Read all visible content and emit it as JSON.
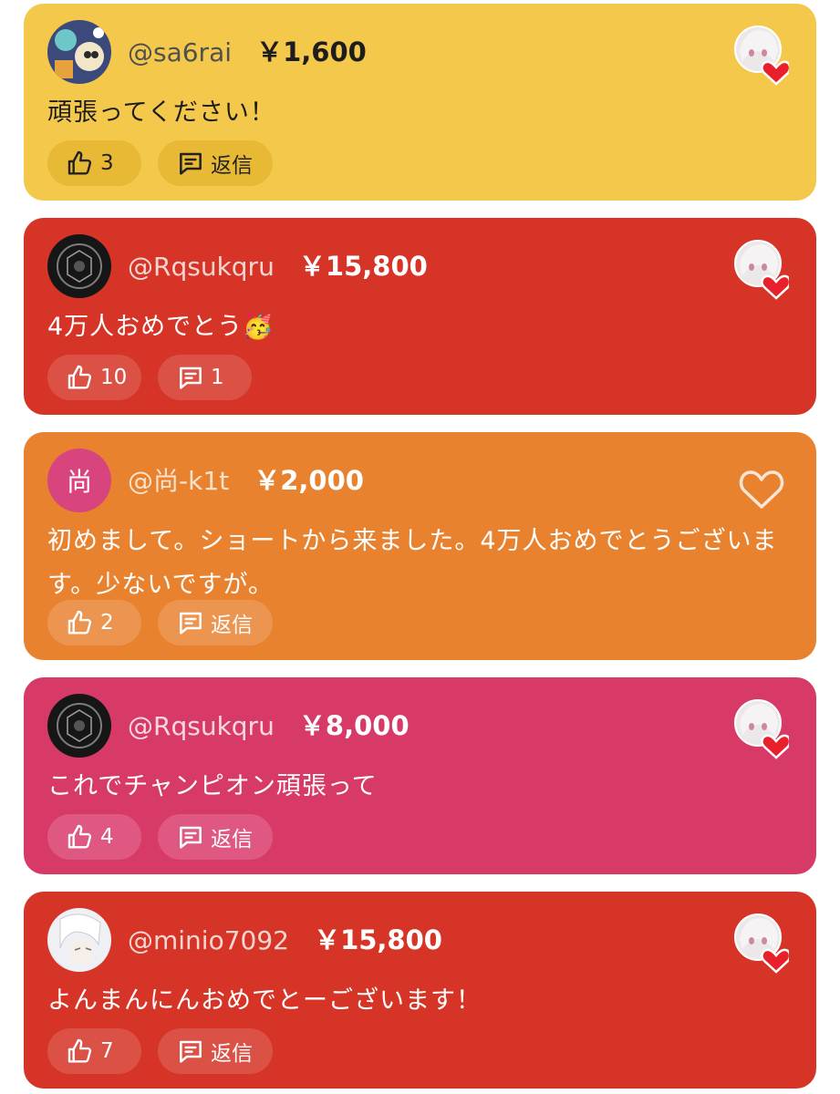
{
  "comments": [
    {
      "theme": "yellow",
      "username": "@sa6rai",
      "amount": "￥1,600",
      "message": "頑張ってください！",
      "likes": "3",
      "reply_label": "返信",
      "creator_hearted": true
    },
    {
      "theme": "red",
      "username": "@Rqsukqru",
      "amount": "￥15,800",
      "message": "4万人おめでとう🥳",
      "likes": "10",
      "reply_label": "1",
      "creator_hearted": true
    },
    {
      "theme": "orange",
      "username": "@尚-k1t",
      "amount": "￥2,000",
      "avatar_letter": "尚",
      "message": "初めまして。ショートから来ました。4万人おめでとうございます。少ないですが。",
      "likes": "2",
      "reply_label": "返信",
      "creator_hearted": false
    },
    {
      "theme": "pink",
      "username": "@Rqsukqru",
      "amount": "￥8,000",
      "message": "これでチャンピオン頑張って",
      "likes": "4",
      "reply_label": "返信",
      "creator_hearted": true
    },
    {
      "theme": "red",
      "username": "@minio7092",
      "amount": "￥15,800",
      "message": "よんまんにんおめでとーございます！",
      "likes": "7",
      "reply_label": "返信",
      "creator_hearted": true
    }
  ]
}
